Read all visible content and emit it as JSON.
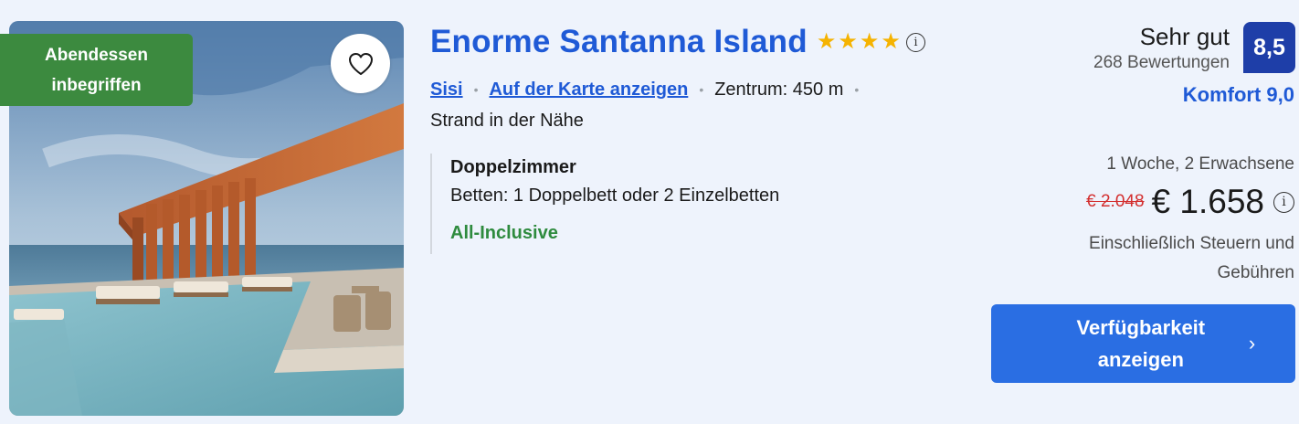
{
  "listing": {
    "meal_badge_line1": "Abendessen",
    "meal_badge_line2": "inbegriffen",
    "title": "Enorme Santanna Island",
    "star_count": 4,
    "stars": [
      "★",
      "★",
      "★",
      "★"
    ],
    "info_glyph": "i",
    "location_link": "Sisi",
    "map_link": "Auf der Karte anzeigen",
    "distance": "Zentrum: 450 m",
    "separator": "•",
    "beach": "Strand in der Nähe",
    "room_type": "Doppelzimmer",
    "beds": "Betten: 1 Doppelbett oder 2 Einzelbetten",
    "board": "All-Inclusive"
  },
  "rating": {
    "word": "Sehr gut",
    "reviews": "268 Bewertungen",
    "score": "8,5",
    "comfort": "Komfort 9,0"
  },
  "pricing": {
    "duration": "1 Woche, 2 Erwachsene",
    "old_price": "€ 2.048",
    "new_price": "€ 1.658",
    "tax_note": "Einschließlich Steuern und Gebühren"
  },
  "cta": {
    "label_line1": "Verfügbarkeit",
    "label_line2": "anzeigen",
    "chevron": "›"
  },
  "icons": {
    "favorite": "heart-outline-icon",
    "info": "info-circle-icon",
    "star": "star-icon",
    "chevron": "chevron-right-icon"
  },
  "colors": {
    "brand_blue": "#1f5ad6",
    "score_badge": "#1e3ea8",
    "cta": "#2a6ee3",
    "meal_badge": "#3c8a3f",
    "board_green": "#2e8b3e",
    "old_price_red": "#d32f2f",
    "star": "#f5b301"
  }
}
